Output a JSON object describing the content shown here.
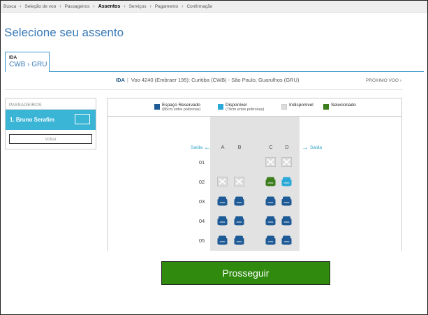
{
  "breadcrumb": [
    "Busca",
    "Seleção de voo",
    "Passageiros",
    "Assentos",
    "Serviços",
    "Pagamento",
    "Confirmação"
  ],
  "breadcrumb_active": "Assentos",
  "page_title": "Selecione seu assento",
  "tab": {
    "label": "IDA",
    "route": "CWB › GRU"
  },
  "flight": {
    "label": "IDA",
    "info": "Voo 4240 (Embraer 195): Curitiba (CWB) - São Paulo, Guarulhos (GRU)"
  },
  "next_flight": "PRÓXIMO VOO ›",
  "passengers": {
    "heading": "PASSAGEIROS",
    "selected": "1. Bruno Serafim",
    "back_button": "Voltar"
  },
  "legend": [
    {
      "id": "reserved",
      "title": "Espaço Reservado",
      "sub": "(86cm entre poltronas)",
      "color": "#1e5a96"
    },
    {
      "id": "available",
      "title": "Disponível",
      "sub": "(79cm entre poltronas)",
      "color": "#2aa9d8"
    },
    {
      "id": "unavailable",
      "title": "Indisponível",
      "sub": "",
      "color": "#dddddd"
    },
    {
      "id": "selected",
      "title": "Selecionado",
      "sub": "",
      "color": "#3c7d1e"
    }
  ],
  "exit_label": "Saída",
  "columns": [
    "A",
    "B",
    "C",
    "D"
  ],
  "rows": [
    "01",
    "02",
    "03",
    "04",
    "05"
  ],
  "seat_status": [
    [
      "none",
      "none",
      "unavailable",
      "unavailable"
    ],
    [
      "unavailable",
      "unavailable",
      "selected",
      "available"
    ],
    [
      "reserved",
      "reserved",
      "reserved",
      "reserved"
    ],
    [
      "reserved",
      "reserved",
      "reserved",
      "reserved"
    ],
    [
      "reserved",
      "reserved",
      "reserved",
      "reserved"
    ]
  ],
  "proceed_button": "Prosseguir"
}
